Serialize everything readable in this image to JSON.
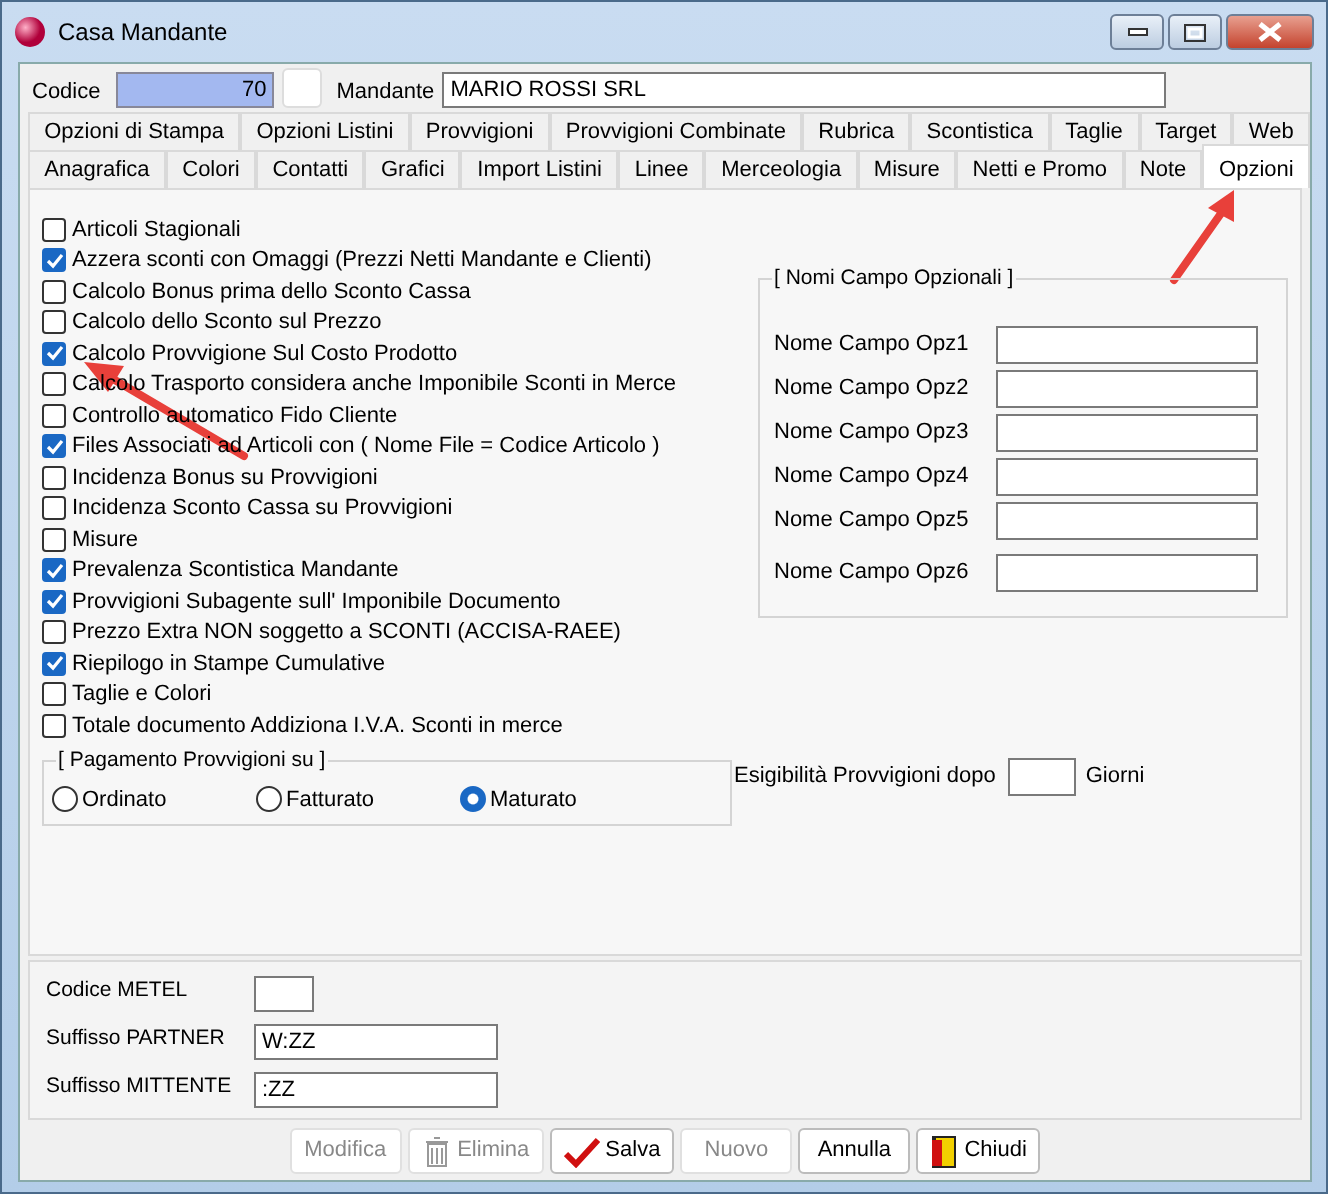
{
  "window": {
    "title": "Casa Mandante"
  },
  "header": {
    "code_label": "Codice",
    "code_value": "70",
    "mandante_label": "Mandante",
    "mandante_value": "MARIO ROSSI SRL"
  },
  "tab_rows": [
    {
      "tabs": [
        {
          "label": "Opzioni di Stampa",
          "selected": false
        },
        {
          "label": "Opzioni Listini",
          "selected": false
        },
        {
          "label": "Provvigioni",
          "selected": false
        },
        {
          "label": "Provvigioni Combinate",
          "selected": false
        },
        {
          "label": "Rubrica",
          "selected": false
        },
        {
          "label": "Scontistica",
          "selected": false
        },
        {
          "label": "Taglie",
          "selected": false
        },
        {
          "label": "Target",
          "selected": false
        },
        {
          "label": "Web",
          "selected": false
        }
      ]
    },
    {
      "tabs": [
        {
          "label": "Anagrafica",
          "selected": false
        },
        {
          "label": "Colori",
          "selected": false
        },
        {
          "label": "Contatti",
          "selected": false
        },
        {
          "label": "Grafici",
          "selected": false
        },
        {
          "label": "Import Listini",
          "selected": false
        },
        {
          "label": "Linee",
          "selected": false
        },
        {
          "label": "Merceologia",
          "selected": false
        },
        {
          "label": "Misure",
          "selected": false
        },
        {
          "label": "Netti e Promo",
          "selected": false
        },
        {
          "label": "Note",
          "selected": false
        },
        {
          "label": "Opzioni",
          "selected": true
        }
      ]
    }
  ],
  "options": [
    {
      "label": "Articoli Stagionali",
      "checked": false
    },
    {
      "label": "Azzera sconti con Omaggi (Prezzi Netti Mandante e Clienti)",
      "checked": true
    },
    {
      "label": "Calcolo Bonus prima dello Sconto Cassa",
      "checked": false
    },
    {
      "label": "Calcolo dello Sconto sul Prezzo",
      "checked": false
    },
    {
      "label": "Calcolo Provvigione Sul Costo Prodotto",
      "checked": true
    },
    {
      "label": "Calcolo Trasporto considera anche Imponibile Sconti in Merce",
      "checked": false
    },
    {
      "label": "Controllo automatico Fido Cliente",
      "checked": false
    },
    {
      "label": "Files Associati ad Articoli con ( Nome File = Codice Articolo )",
      "checked": true
    },
    {
      "label": "Incidenza Bonus su Provvigioni",
      "checked": false
    },
    {
      "label": "Incidenza Sconto Cassa su Provvigioni",
      "checked": false
    },
    {
      "label": "Misure",
      "checked": false
    },
    {
      "label": "Prevalenza Scontistica Mandante",
      "checked": true
    },
    {
      "label": "Provvigioni Subagente sull' Imponibile Documento",
      "checked": true
    },
    {
      "label": "Prezzo Extra NON soggetto a SCONTI (ACCISA-RAEE)",
      "checked": false
    },
    {
      "label": "Riepilogo in Stampe Cumulative",
      "checked": true
    },
    {
      "label": "Taglie e Colori",
      "checked": false
    },
    {
      "label": "Totale documento  Addiziona I.V.A. Sconti in merce",
      "checked": false
    }
  ],
  "payment": {
    "title": "[ Pagamento Provvigioni su ]",
    "options": [
      {
        "label": "Ordinato",
        "selected": false
      },
      {
        "label": "Fatturato",
        "selected": false
      },
      {
        "label": "Maturato",
        "selected": true
      }
    ]
  },
  "optional_fields": {
    "title": "[ Nomi Campo Opzionali ]",
    "fields": [
      {
        "label": "Nome Campo Opz1"
      },
      {
        "label": "Nome Campo Opz2"
      },
      {
        "label": "Nome Campo Opz3"
      },
      {
        "label": "Nome Campo Opz4"
      },
      {
        "label": "Nome Campo Opz5"
      },
      {
        "label": "Nome Campo Opz6"
      }
    ]
  },
  "esigibilita": {
    "label": "Esigibilità Provvigioni dopo",
    "unit": "Giorni"
  },
  "codes": [
    {
      "label": "Codice METEL",
      "kind": "short"
    },
    {
      "label": "Suffisso PARTNER",
      "value": "W:ZZ",
      "kind": "long"
    },
    {
      "label": "Suffisso MITTENTE",
      "value": ":ZZ",
      "kind": "long"
    }
  ],
  "buttons": [
    {
      "label": "Modifica",
      "disabled": true,
      "kind": "plain"
    },
    {
      "label": "Elimina",
      "disabled": true,
      "kind": "trash"
    },
    {
      "label": "Salva",
      "disabled": false,
      "kind": "check"
    },
    {
      "label": "Nuovo",
      "disabled": true,
      "kind": "plain"
    },
    {
      "label": "Annulla",
      "disabled": false,
      "kind": "plain"
    },
    {
      "label": "Chiudi",
      "disabled": false,
      "kind": "door"
    }
  ]
}
